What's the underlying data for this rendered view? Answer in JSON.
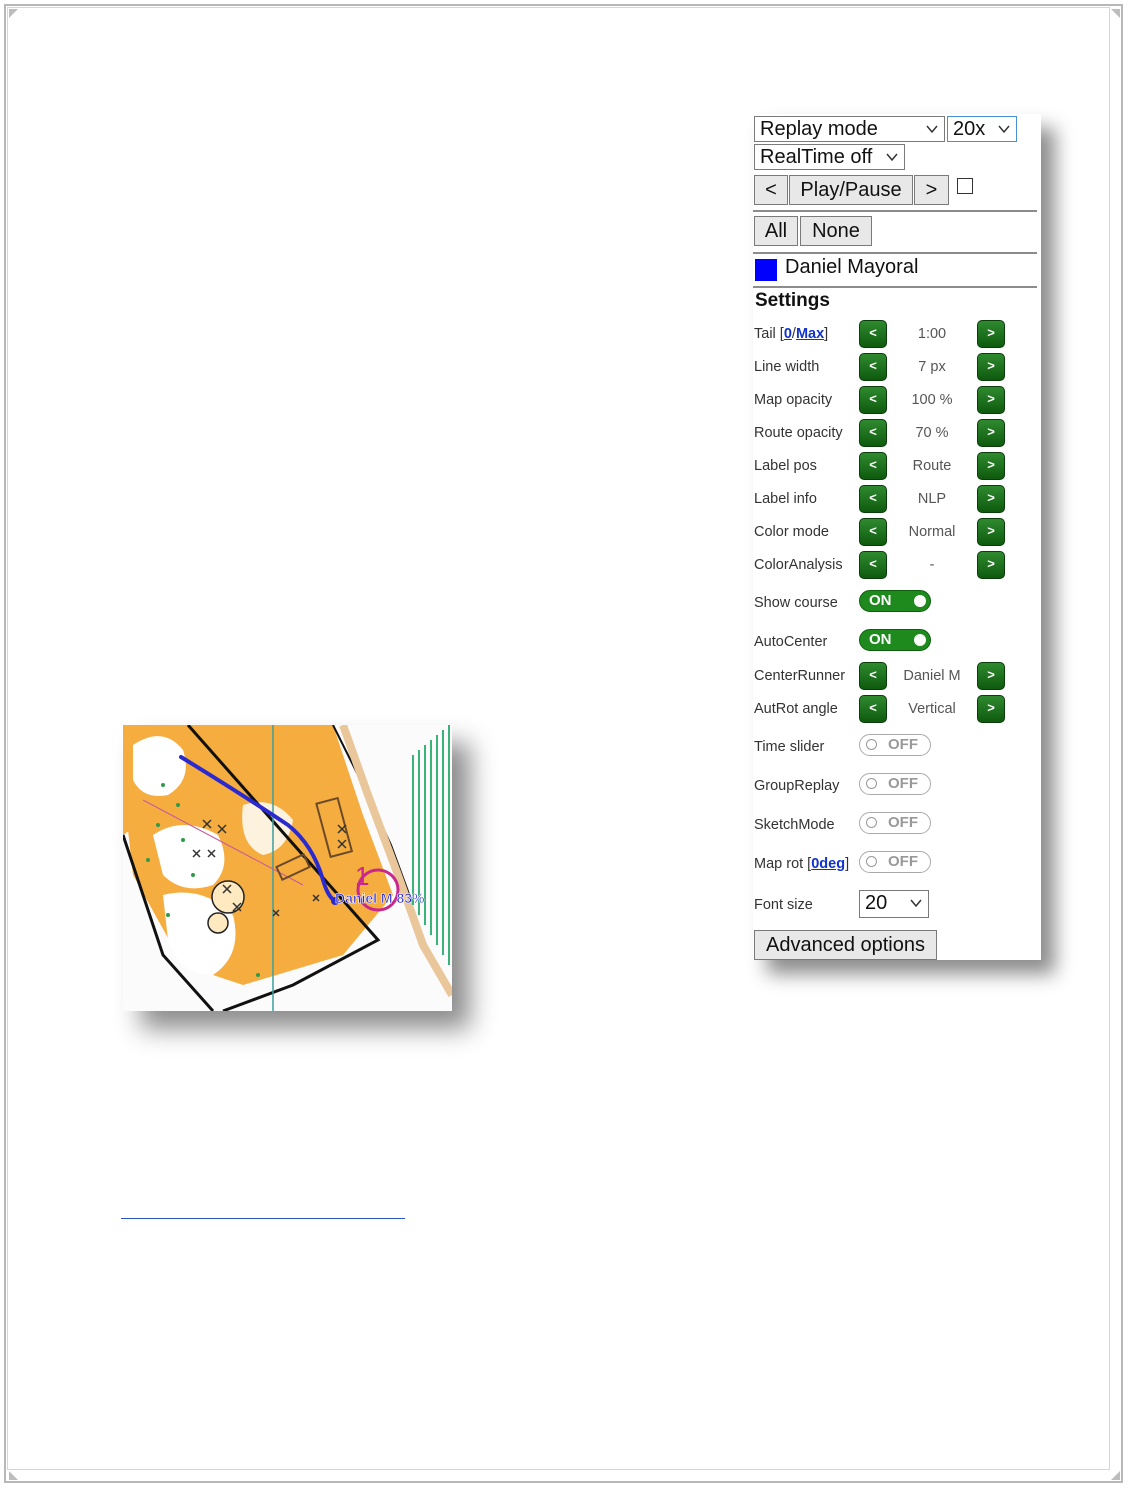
{
  "panel": {
    "mode_select": {
      "value": "Replay mode"
    },
    "speed_select": {
      "value": "20x"
    },
    "realtime_select": {
      "value": "RealTime off"
    },
    "nav": {
      "prev": "<",
      "play_pause": "Play/Pause",
      "next": ">",
      "loop_checked": false
    },
    "selection": {
      "all": "All",
      "none": "None"
    },
    "runner": {
      "name": "Daniel Mayoral",
      "color": "#0000ff"
    },
    "settings_title": "Settings",
    "settings": [
      {
        "label": "Tail [",
        "link1": "0",
        "sep": "/",
        "link2": "Max",
        "end": "]",
        "value": "1:00"
      },
      {
        "label": "Line width",
        "value": "7 px"
      },
      {
        "label": "Map opacity",
        "value": "100 %"
      },
      {
        "label": "Route opacity",
        "value": "70 %"
      },
      {
        "label": "Label pos",
        "value": "Route"
      },
      {
        "label": "Label info",
        "value": "NLP"
      },
      {
        "label": "Color mode",
        "value": "Normal"
      },
      {
        "label": "ColorAnalysis",
        "value": "-"
      }
    ],
    "toggles_on": [
      {
        "label": "Show course",
        "state": "ON"
      },
      {
        "label": "AutoCenter",
        "state": "ON"
      }
    ],
    "steppers2": [
      {
        "label": "CenterRunner",
        "value": "Daniel M"
      },
      {
        "label": "AutRot angle",
        "value": "Vertical"
      }
    ],
    "toggles_off": [
      {
        "label": "Time slider",
        "state": "OFF"
      },
      {
        "label": "GroupReplay",
        "state": "OFF"
      },
      {
        "label": "SketchMode",
        "state": "OFF"
      },
      {
        "label": "Map rot [",
        "link": "0deg",
        "end": "]",
        "state": "OFF"
      }
    ],
    "font_size": {
      "label": "Font size",
      "value": "20"
    },
    "advanced": "Advanced options",
    "step_prev": "<",
    "step_next": ">"
  },
  "map": {
    "runner_label": "Daniel M 83%",
    "control_number": "1",
    "route_color": "#2a2ad0"
  }
}
